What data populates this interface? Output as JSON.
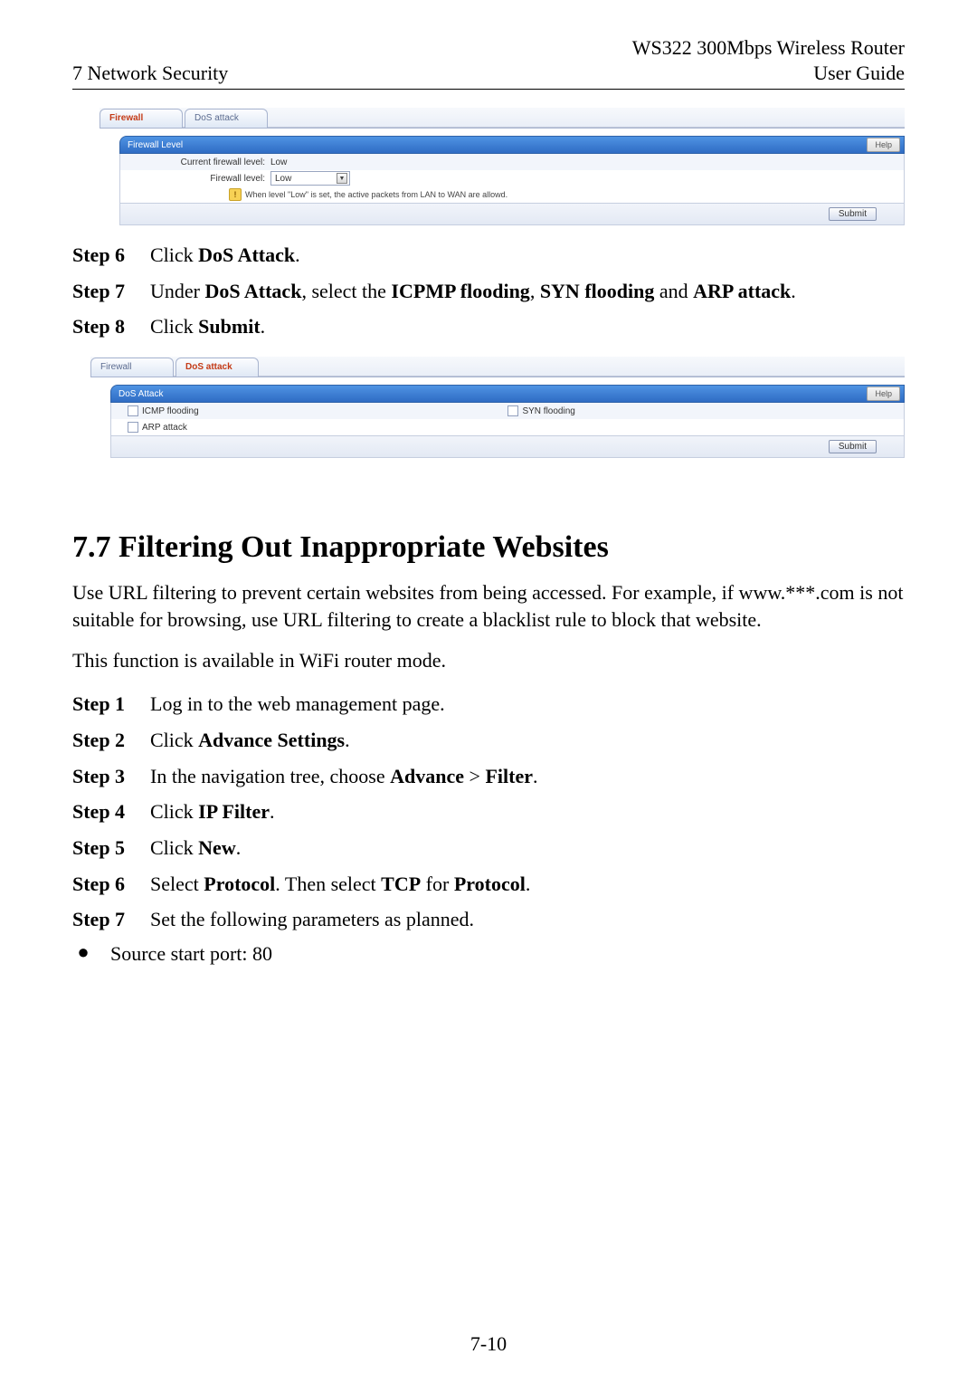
{
  "header": {
    "product": "WS322 300Mbps Wireless Router",
    "left": "7 Network Security",
    "right": "User Guide"
  },
  "panel1": {
    "tab1": "Firewall",
    "tab2": "DoS attack",
    "bar_title": "Firewall Level",
    "help": "Help",
    "row1_label": "Current firewall level:",
    "row1_value": "Low",
    "row2_label": "Firewall level:",
    "row2_value": "Low",
    "note": "When level \"Low\" is set, the active packets from LAN to WAN are allowd.",
    "submit": "Submit"
  },
  "stepsA": {
    "s6_label": "Step 6",
    "s6_text_a": "Click ",
    "s6_bold": "DoS Attack",
    "s6_text_b": ".",
    "s7_label": "Step 7",
    "s7_a": "Under ",
    "s7_b1": "DoS Attack",
    "s7_b": ", select the ",
    "s7_b2": "ICPMP flooding",
    "s7_c": ", ",
    "s7_b3": "SYN flooding",
    "s7_d": " and ",
    "s7_b4": "ARP attack",
    "s7_e": ".",
    "s8_label": "Step 8",
    "s8_a": "Click ",
    "s8_b1": "Submit",
    "s8_b": "."
  },
  "panel2": {
    "tab1": "Firewall",
    "tab2": "DoS attack",
    "bar_title": "DoS Attack",
    "help": "Help",
    "opt1": "ICMP flooding",
    "opt2": "SYN flooding",
    "opt3": "ARP attack",
    "submit": "Submit"
  },
  "section77": {
    "title": "7.7 Filtering Out Inappropriate Websites",
    "p1": "Use URL filtering to prevent certain websites from being accessed. For example, if www.***.com is not suitable for browsing, use URL filtering to create a blacklist rule to block that website.",
    "p2": "This function is available in WiFi router mode."
  },
  "stepsB": {
    "s1l": "Step 1",
    "s1t": "Log in to the web management page.",
    "s2l": "Step 2",
    "s2a": "Click ",
    "s2b": "Advance Settings",
    "s2c": ".",
    "s3l": "Step 3",
    "s3a": "In the navigation tree, choose ",
    "s3b": "Advance",
    "s3c": " > ",
    "s3d": "Filter",
    "s3e": ".",
    "s4l": "Step 4",
    "s4a": "Click ",
    "s4b": "IP Filter",
    "s4c": ".",
    "s5l": "Step 5",
    "s5a": "Click ",
    "s5b": "New",
    "s5c": ".",
    "s6l": "Step 6",
    "s6a": "Select ",
    "s6b": "Protocol",
    "s6c": ". Then select ",
    "s6d": "TCP",
    "s6e": " for ",
    "s6f": "Protocol",
    "s6g": ".",
    "s7l": "Step 7",
    "s7t": "Set the following parameters as planned."
  },
  "bullet1": "Source start port: 80",
  "page_number": "7-10"
}
